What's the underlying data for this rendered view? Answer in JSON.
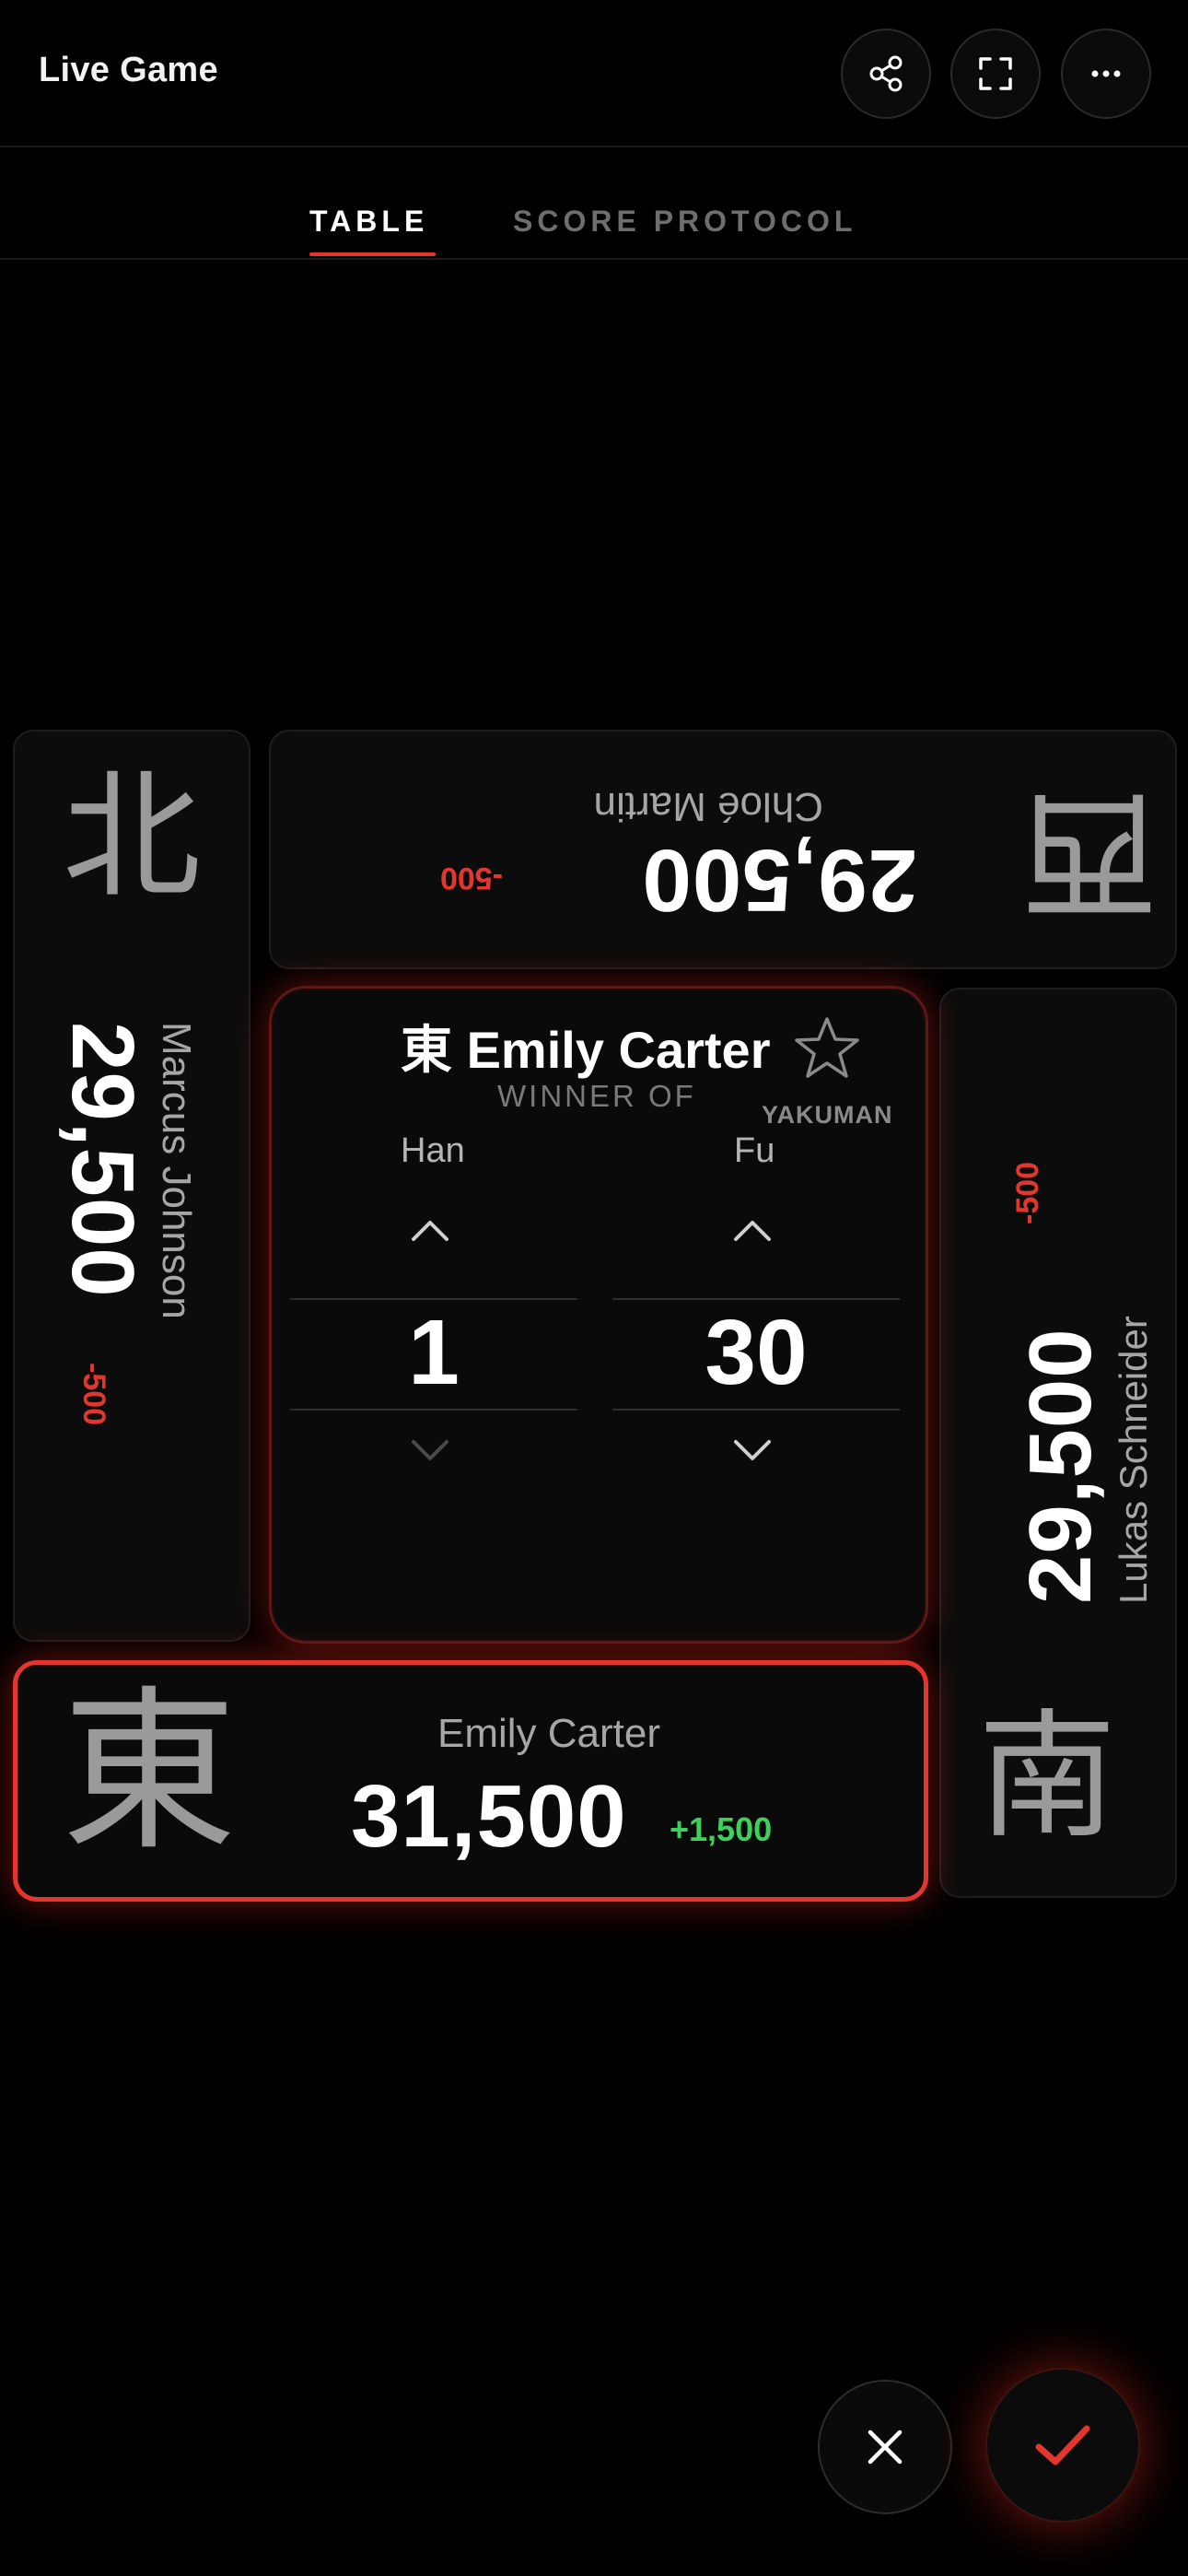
{
  "header": {
    "title": "Live Game",
    "buttons": [
      {
        "icon": "share-icon"
      },
      {
        "icon": "fullscreen-icon"
      },
      {
        "icon": "more-icon"
      }
    ]
  },
  "tabs": [
    {
      "label": "TABLE",
      "active": true
    },
    {
      "label": "SCORE PROTOCOL",
      "active": false
    }
  ],
  "players": {
    "north": {
      "wind": "西",
      "name": "Chloé Martin",
      "score": "29,500",
      "delta": "-500"
    },
    "west": {
      "wind": "北",
      "name": "Marcus Johnson",
      "score": "29,500",
      "delta": "-500"
    },
    "east": {
      "wind": "南",
      "name": "Lukas Schneider",
      "score": "29,500",
      "delta": "-500"
    },
    "south": {
      "wind": "東",
      "name": "Emily Carter",
      "score": "31,500",
      "delta": "+1,500"
    }
  },
  "winner": {
    "wind": "東",
    "name": "Emily Carter",
    "caption": "WINNER OF",
    "yakuman_label": "YAKUMAN",
    "han_label": "Han",
    "fu_label": "Fu",
    "han": "1",
    "fu": "30"
  },
  "colors": {
    "accent": "#e2362f",
    "positive": "#3fcf5a",
    "background": "#000000"
  }
}
